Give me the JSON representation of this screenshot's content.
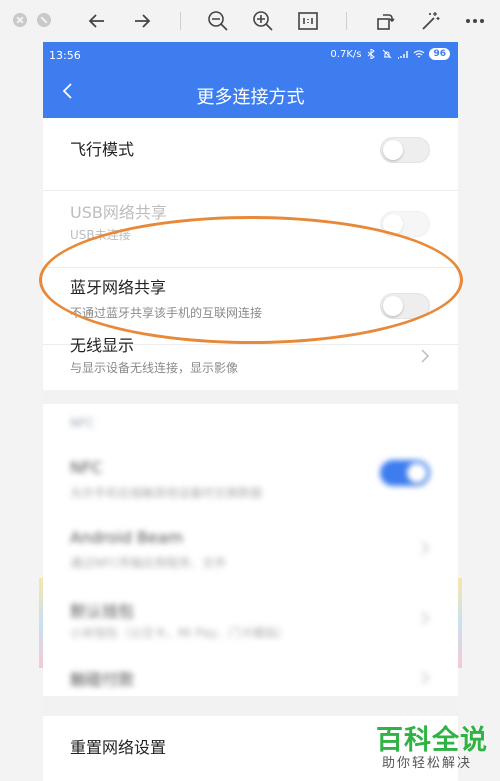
{
  "status": {
    "time": "13:56",
    "speed": "0.7K/s",
    "battery": "96"
  },
  "header": {
    "title": "更多连接方式"
  },
  "rows": [
    {
      "title": "飞行模式"
    },
    {
      "title": "USB网络共享",
      "subtitle": "USB未连接"
    },
    {
      "title": "蓝牙网络共享",
      "subtitle": "不通过蓝牙共享该手机的互联网连接"
    },
    {
      "title": "无线显示",
      "subtitle": "与显示设备无线连接，显示影像"
    }
  ],
  "blurred_section": {
    "section_label": "NFC",
    "items": [
      {
        "title": "NFC",
        "subtitle": "允许手机在接触其他设备时交换数据"
      },
      {
        "title": "Android Beam",
        "subtitle": "通过NFC传输应用程序、文件"
      },
      {
        "title": "默认钱包",
        "subtitle": "小米钱包（公交卡、Mi Pay、门卡模拟）"
      },
      {
        "title": "触碰付款"
      }
    ]
  },
  "reset_row": {
    "title": "重置网络设置"
  },
  "watermark": {
    "main": "百科全说",
    "sub": "助你轻松解决"
  },
  "colors": {
    "header": "#3d7df0",
    "highlight": "#e8893a",
    "watermark": "#2fb344"
  }
}
